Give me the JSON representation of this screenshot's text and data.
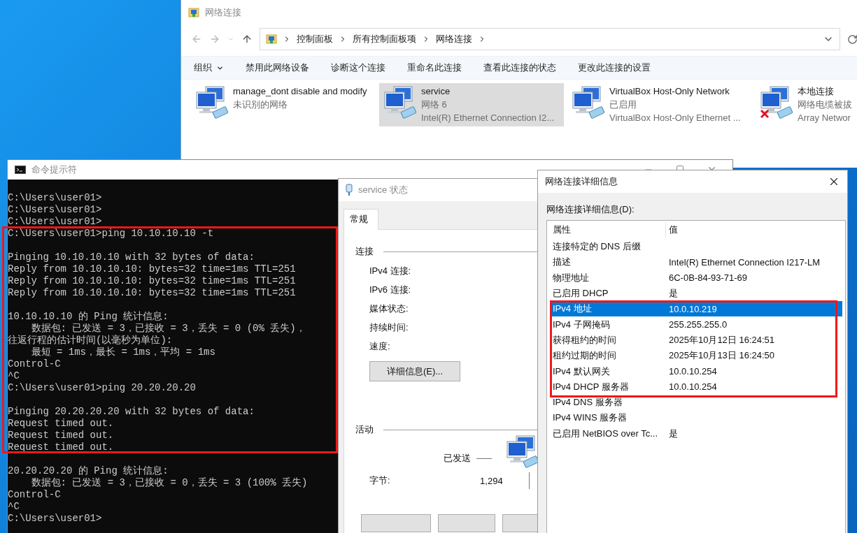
{
  "explorer": {
    "title": "网络连接",
    "breadcrumb": [
      "控制面板",
      "所有控制面板项",
      "网络连接"
    ],
    "commands": [
      {
        "label": "组织",
        "kind": "menu"
      },
      {
        "label": "禁用此网络设备",
        "kind": "action"
      },
      {
        "label": "诊断这个连接",
        "kind": "action"
      },
      {
        "label": "重命名此连接",
        "kind": "action"
      },
      {
        "label": "查看此连接的状态",
        "kind": "action"
      },
      {
        "label": "更改此连接的设置",
        "kind": "action"
      }
    ],
    "connections": [
      {
        "name": "manage_dont disable and modify",
        "status": "未识别的网络",
        "selected": false,
        "disconnected": false
      },
      {
        "name": "service",
        "status": "网络 6",
        "device": "Intel(R) Ethernet Connection I2...",
        "selected": true,
        "disconnected": false
      },
      {
        "name": "VirtualBox Host-Only Network",
        "status": "已启用",
        "device": "VirtualBox Host-Only Ethernet ...",
        "selected": false,
        "disconnected": false
      },
      {
        "name": "本地连接",
        "status": "网络电缆被拔",
        "device": "Array Networ",
        "selected": false,
        "disconnected": true
      }
    ]
  },
  "cmd": {
    "title": "命令提示符",
    "blocks": [
      [
        "C:\\Users\\user01>",
        "C:\\Users\\user01>",
        "C:\\Users\\user01>",
        "C:\\Users\\user01>ping 10.10.10.10 -t"
      ],
      [
        "Pinging 10.10.10.10 with 32 bytes of data:",
        "Reply from 10.10.10.10: bytes=32 time=1ms TTL=251",
        "Reply from 10.10.10.10: bytes=32 time=1ms TTL=251",
        "Reply from 10.10.10.10: bytes=32 time=1ms TTL=251"
      ],
      [
        "10.10.10.10 的 Ping 统计信息:",
        "    数据包: 已发送 = 3，已接收 = 3，丢失 = 0 (0% 丢失)，",
        "往返行程的估计时间(以毫秒为单位):",
        "    最短 = 1ms，最长 = 1ms，平均 = 1ms",
        "Control-C",
        "^C",
        "C:\\Users\\user01>ping 20.20.20.20"
      ],
      [
        "Pinging 20.20.20.20 with 32 bytes of data:",
        "Request timed out.",
        "Request timed out.",
        "Request timed out."
      ],
      [
        "20.20.20.20 的 Ping 统计信息:",
        "    数据包: 已发送 = 3，已接收 = 0，丢失 = 3 (100% 丢失)",
        "Control-C",
        "^C",
        "C:\\Users\\user01>"
      ]
    ]
  },
  "status_dialog": {
    "title": "service 状态",
    "tabs": [
      {
        "label": "常规",
        "selected": true
      }
    ],
    "connection_heading": "连接",
    "connection_fields": [
      "IPv4 连接:",
      "IPv6 连接:",
      "媒体状态:",
      "持续时间:",
      "速度:"
    ],
    "details_button": "详细信息(E)...",
    "activity_heading": "活动",
    "sent_label": "已发送",
    "bytes_label": "字节:",
    "bytes_sent": "1,294"
  },
  "details_dialog": {
    "title": "网络连接详细信息",
    "list_label": "网络连接详细信息(D):",
    "columns": [
      "属性",
      "值"
    ],
    "rows": [
      {
        "property": "连接特定的 DNS 后缀",
        "selected": false
      },
      {
        "property": "描述",
        "value": "Intel(R) Ethernet Connection I217-LM",
        "selected": false
      },
      {
        "property": "物理地址",
        "value": "6C-0B-84-93-71-69",
        "selected": false
      },
      {
        "property": "已启用 DHCP",
        "value": "是",
        "selected": false
      },
      {
        "property": "IPv4 地址",
        "value": "10.0.10.219",
        "selected": true
      },
      {
        "property": "IPv4 子网掩码",
        "value": "255.255.255.0",
        "selected": false
      },
      {
        "property": "获得租约的时间",
        "value": "2025年10月12日 16:24:51",
        "selected": false
      },
      {
        "property": "租约过期的时间",
        "value": "2025年10月13日 16:24:50",
        "selected": false
      },
      {
        "property": "IPv4 默认网关",
        "value": "10.0.10.254",
        "selected": false
      },
      {
        "property": "IPv4 DHCP 服务器",
        "value": "10.0.10.254",
        "selected": false
      },
      {
        "property": "IPv4 DNS 服务器",
        "selected": false
      },
      {
        "property": "IPv4 WINS 服务器",
        "selected": false
      },
      {
        "property": "已启用 NetBIOS over Tc...",
        "value": "是",
        "selected": false
      }
    ]
  }
}
